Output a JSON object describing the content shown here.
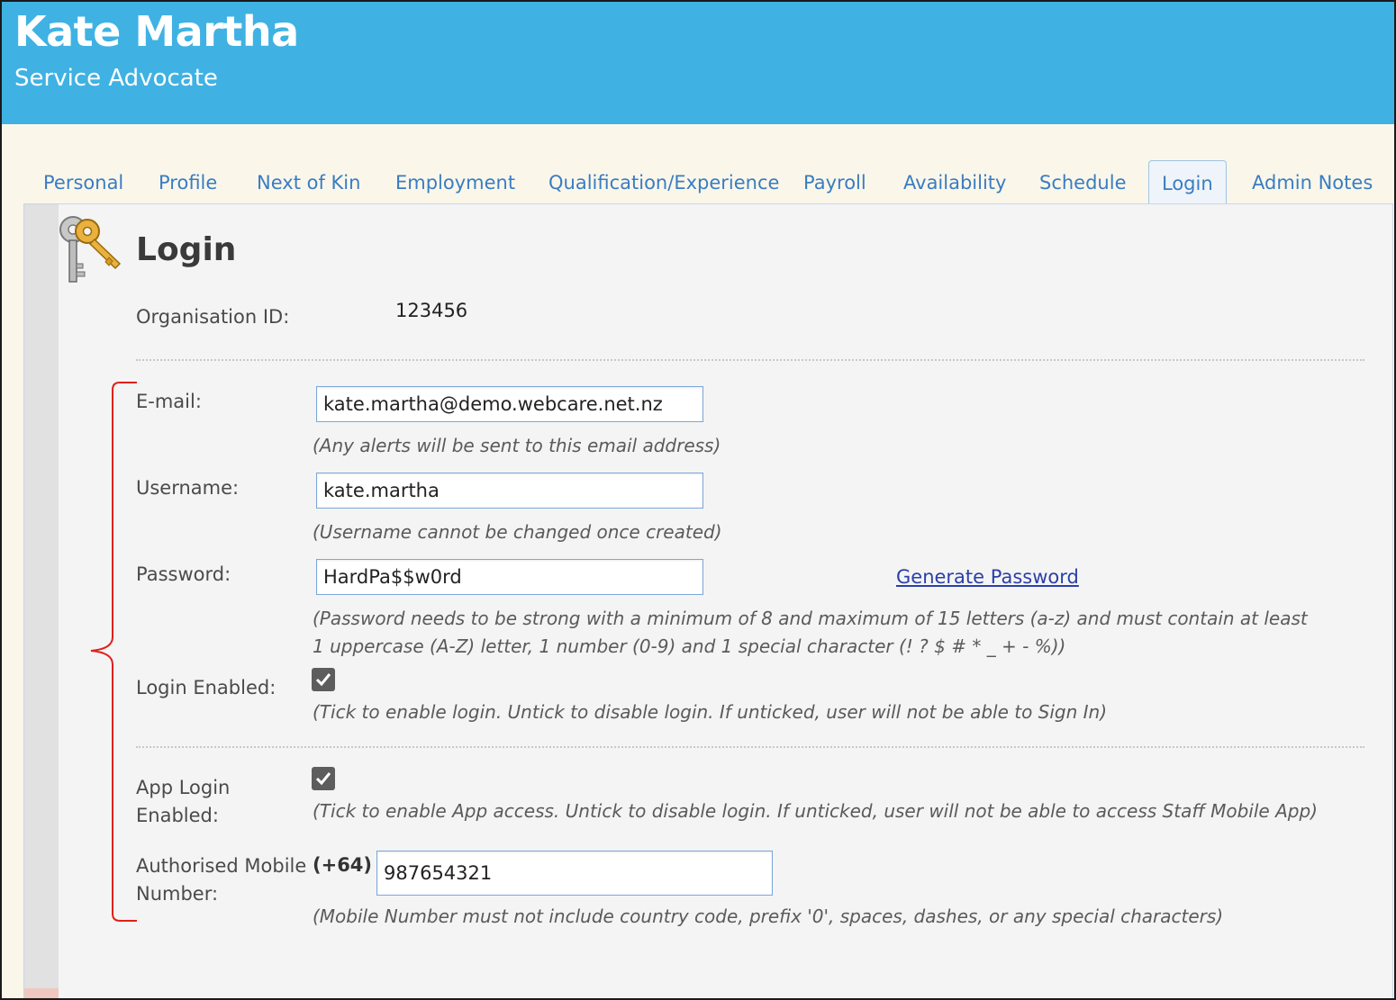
{
  "header": {
    "name": "Kate Martha",
    "role": "Service Advocate",
    "background_color": "#3fb2e3"
  },
  "tabs": [
    {
      "label": "Personal"
    },
    {
      "label": "Profile"
    },
    {
      "label": "Next of Kin"
    },
    {
      "label": "Employment"
    },
    {
      "label": "Qualification/Experience"
    },
    {
      "label": "Payroll"
    },
    {
      "label": "Availability"
    },
    {
      "label": "Schedule"
    },
    {
      "label": "Login",
      "active": true
    },
    {
      "label": "Admin Notes"
    }
  ],
  "login": {
    "title": "Login",
    "icon": "keys-icon",
    "organisation_id_label": "Organisation ID:",
    "organisation_id_value": "123456",
    "email_label": "E-mail:",
    "email_value": "kate.martha@demo.webcare.net.nz",
    "email_hint": "(Any alerts will be sent to this email address)",
    "username_label": "Username:",
    "username_value": "kate.martha",
    "username_hint": "(Username cannot be changed once created)",
    "password_label": "Password:",
    "password_value": "HardPa$$w0rd",
    "generate_password_link": "Generate Password",
    "password_hint_line1": "(Password needs to be strong with a minimum of 8 and maximum of 15 letters (a-z) and must contain at least",
    "password_hint_line2": "1 uppercase (A-Z) letter, 1 number (0-9) and 1 special character (! ? $ # * _ + - %))",
    "login_enabled_label": "Login Enabled:",
    "login_enabled_checked": true,
    "login_enabled_hint": "(Tick to enable login. Untick to disable login. If unticked, user will not be able to Sign In)",
    "app_login_label_line1": "App Login",
    "app_login_label_line2": "Enabled:",
    "app_login_checked": true,
    "app_login_hint": "(Tick to enable App access. Untick to disable login. If unticked, user will not be able to access Staff Mobile App)",
    "mobile_label_line1": "Authorised Mobile",
    "mobile_label_line2": "Number:",
    "mobile_prefix": "(+64)",
    "mobile_value": "987654321",
    "mobile_hint": "(Mobile Number must not include country code, prefix '0', spaces, dashes, or any special characters)"
  },
  "colors": {
    "link": "#2b3fa8",
    "tab_text": "#3a7cc2",
    "annotation_bracket": "#e0201b"
  }
}
